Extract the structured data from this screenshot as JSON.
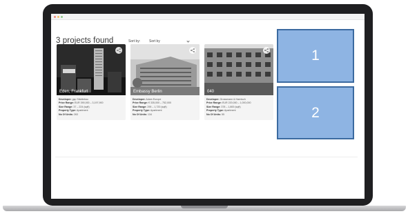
{
  "results": {
    "title": "3 projects found",
    "sort_label": "Sort by:",
    "sort_value": "Sort by"
  },
  "projects": [
    {
      "name": "Eden, Frankfurt",
      "developer_label": "Developer:",
      "developer": "gsp Städtebau",
      "price_label": "Price Range:",
      "price": "EUR 390,000 – 3,197,900",
      "size_label": "Size Range:",
      "size": "37 – 224 (sqft)",
      "type_label": "Property Type:",
      "type": "Apartment",
      "units_label": "No Of Units:",
      "units": "263"
    },
    {
      "name": "Embassy Berlin",
      "developer_label": "Developer:",
      "developer": "Adam Europe",
      "price_label": "Price Range:",
      "price": "€ 335,000 – 752,000",
      "size_label": "Size Range:",
      "size": "295 – 1,720 (sqft)",
      "type_label": "Property Type:",
      "type": "Apartment",
      "units_label": "No Of Units:",
      "units": "134"
    },
    {
      "name": "040",
      "developer_label": "Developer:",
      "developer": "Grossmann & Harnisch",
      "price_label": "Price Range:",
      "price": "EUR 220,000 – 1,000,000",
      "size_label": "Size Range:",
      "size": "378 – 1,800 (sqft)",
      "type_label": "Property Type:",
      "type": "Apartment",
      "units_label": "No Of Units:",
      "units": "55"
    }
  ],
  "overlays": {
    "box1": "1",
    "box2": "2"
  },
  "colors": {
    "overlay_fill": "#8eb4e3",
    "overlay_border": "#3b6aa0",
    "bezel": "#1f1f21"
  }
}
